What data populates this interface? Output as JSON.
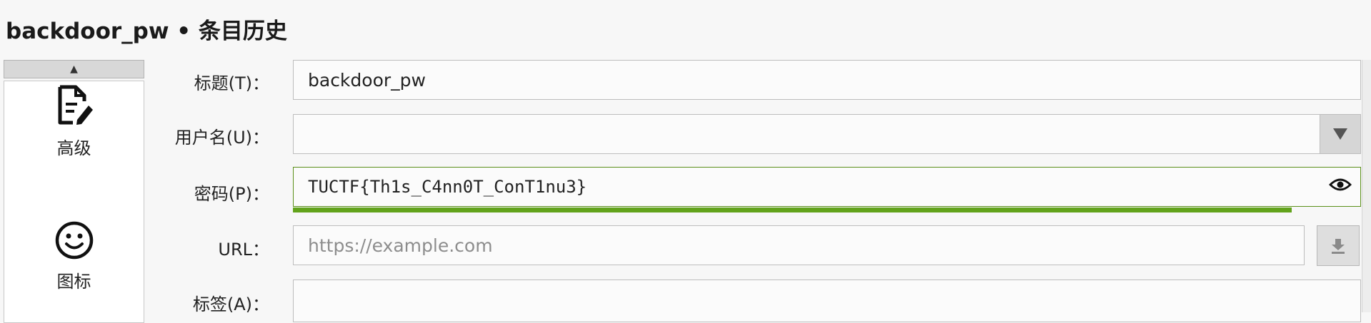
{
  "window": {
    "title": "backdoor_pw • 条目历史"
  },
  "sidebar": {
    "scroll_up_glyph": "▲",
    "items": [
      {
        "label": "高级",
        "icon": "document-edit-icon"
      },
      {
        "label": "图标",
        "icon": "smiley-icon"
      }
    ]
  },
  "form": {
    "title_label": "标题(T)：",
    "title_value": "backdoor_pw",
    "username_label": "用户名(U)：",
    "username_value": "",
    "password_label": "密码(P)：",
    "password_value": "TUCTF{Th1s_C4nn0T_ConT1nu3}",
    "password_strength": 0.935,
    "url_label": "URL：",
    "url_placeholder": "https://example.com",
    "tags_label": "标签(A)："
  },
  "colors": {
    "strength_bar": "#62a31b",
    "password_border": "#5b8f1a"
  }
}
